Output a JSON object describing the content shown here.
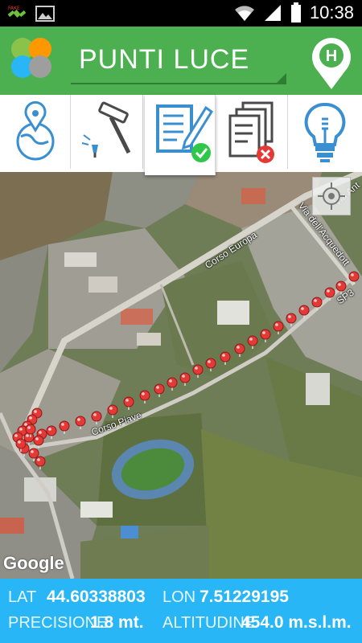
{
  "status_bar": {
    "time": "10:38",
    "icons": [
      "satellite-icon",
      "image-icon",
      "wifi-icon",
      "signal-icon",
      "battery-icon"
    ]
  },
  "app_bar": {
    "title": "PUNTI LUCE",
    "logo": "clover-logo",
    "action_icon": "location-pin-h-icon"
  },
  "toolbar": {
    "tools": [
      {
        "icon": "globe-pin-icon"
      },
      {
        "icon": "hammer-icon"
      },
      {
        "icon": "document-edit-check-icon",
        "active": true
      },
      {
        "icon": "documents-delete-icon"
      },
      {
        "icon": "lightbulb-icon"
      }
    ]
  },
  "map": {
    "labels": {
      "corso_europa": "Corso Europa",
      "corso_piave": "Corso Piave",
      "via_acquedotto": "Via dell'Acquedott",
      "via_ant": "Via Ant",
      "sp": "SP3"
    },
    "google": "Google",
    "marker_color": "#e53935"
  },
  "info": {
    "lat_label": "LAT",
    "lat_value": "44.60338803",
    "lon_label": "LON",
    "lon_value": "7.51229195",
    "precision_label": "PRECISIONE",
    "precision_value": "1.8 mt.",
    "altitude_label": "ALTITUDINE",
    "altitude_value": "454.0 m.s.l.m."
  },
  "colors": {
    "app_bar": "#4caf50",
    "info_bar": "#29b6f6",
    "tool_icon": "#3a8fd0"
  }
}
